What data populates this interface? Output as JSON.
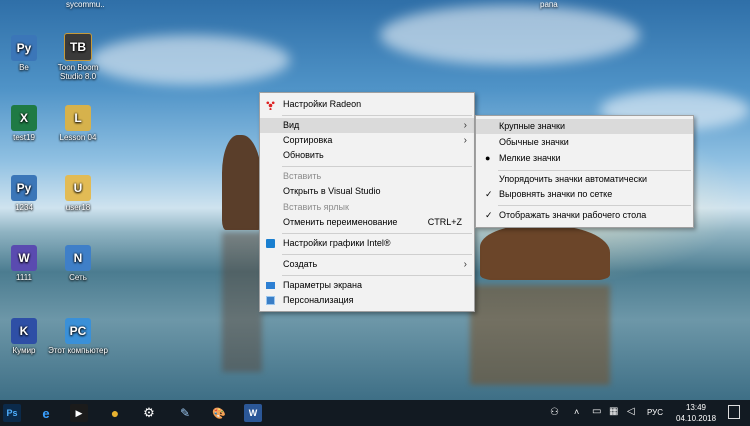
{
  "desktop": {
    "top_labels": [
      "",
      "sycommu..",
      "рапа"
    ],
    "icons": [
      {
        "label": "Be",
        "name": "python-file-be",
        "glyph": "Py",
        "color": "#3b76b8"
      },
      {
        "label": "Toon Boom Studio 8.0",
        "name": "toon-boom-studio",
        "glyph": "TB",
        "color": "#3a3a3a"
      },
      {
        "label": "test19",
        "name": "excel-test19",
        "glyph": "X",
        "color": "#1f7a45"
      },
      {
        "label": "Lesson 04",
        "name": "lesson-04",
        "glyph": "L",
        "color": "#d6b24c"
      },
      {
        "label": "1234",
        "name": "python-file-1234",
        "glyph": "Py",
        "color": "#3b76b8"
      },
      {
        "label": "user18",
        "name": "user18-folder",
        "glyph": "U",
        "color": "#e2bb55"
      },
      {
        "label": "1111",
        "name": "file-1111",
        "glyph": "W",
        "color": "#5a4bb0"
      },
      {
        "label": "Сеть",
        "name": "network",
        "glyph": "N",
        "color": "#3f7fc8"
      },
      {
        "label": "Кумир",
        "name": "kumir",
        "glyph": "K",
        "color": "#2e4fa6"
      },
      {
        "label": "Этот компьютер",
        "name": "this-pc",
        "glyph": "PC",
        "color": "#3a90d8"
      }
    ]
  },
  "context_menu": {
    "items": [
      {
        "label": "Настройки Radeon",
        "icon": "radeon-icon"
      },
      {
        "label": "Вид",
        "submenu": true,
        "highlight": true
      },
      {
        "label": "Сортировка",
        "submenu": true
      },
      {
        "label": "Обновить"
      },
      {
        "label": "Вставить",
        "disabled": true
      },
      {
        "label": "Открыть в Visual Studio"
      },
      {
        "label": "Вставить ярлык",
        "disabled": true
      },
      {
        "label": "Отменить переименование",
        "shortcut": "CTRL+Z"
      },
      {
        "label": "Настройки графики Intel®",
        "icon": "intel-graphics-icon"
      },
      {
        "label": "Создать",
        "submenu": true
      },
      {
        "label": "Параметры экрана",
        "icon": "display-settings-icon"
      },
      {
        "label": "Персонализация",
        "icon": "personalization-icon"
      }
    ]
  },
  "view_submenu": {
    "items": [
      {
        "label": "Крупные значки",
        "highlight": true,
        "mark": ""
      },
      {
        "label": "Обычные значки",
        "mark": ""
      },
      {
        "label": "Мелкие значки",
        "mark": "●"
      },
      {
        "label": "Упорядочить значки автоматически",
        "mark": ""
      },
      {
        "label": "Выровнять значки по сетке",
        "mark": "✓"
      },
      {
        "label": "Отображать значки рабочего стола",
        "mark": "✓"
      }
    ]
  },
  "taskbar": {
    "apps": [
      {
        "name": "photoshop-icon",
        "glyph": "Ps",
        "color": "#0b2a4a"
      },
      {
        "name": "edge-icon",
        "glyph": "e",
        "color": "#1565c0"
      },
      {
        "name": "media-player-icon",
        "glyph": "▶",
        "color": "#1b1b1b"
      },
      {
        "name": "chrome-icon",
        "glyph": "●",
        "color": "#dd4b39"
      },
      {
        "name": "settings-icon",
        "glyph": "⚙",
        "color": "#2a2a2a"
      },
      {
        "name": "paint-brush-icon",
        "glyph": "✎",
        "color": "#4a7fb3"
      },
      {
        "name": "palette-icon",
        "glyph": "🎨",
        "color": "#3b3b3b"
      },
      {
        "name": "word-icon",
        "glyph": "W",
        "color": "#2b5797"
      }
    ],
    "language": "РУС",
    "time": "13:49",
    "date": "04.10.2018"
  }
}
